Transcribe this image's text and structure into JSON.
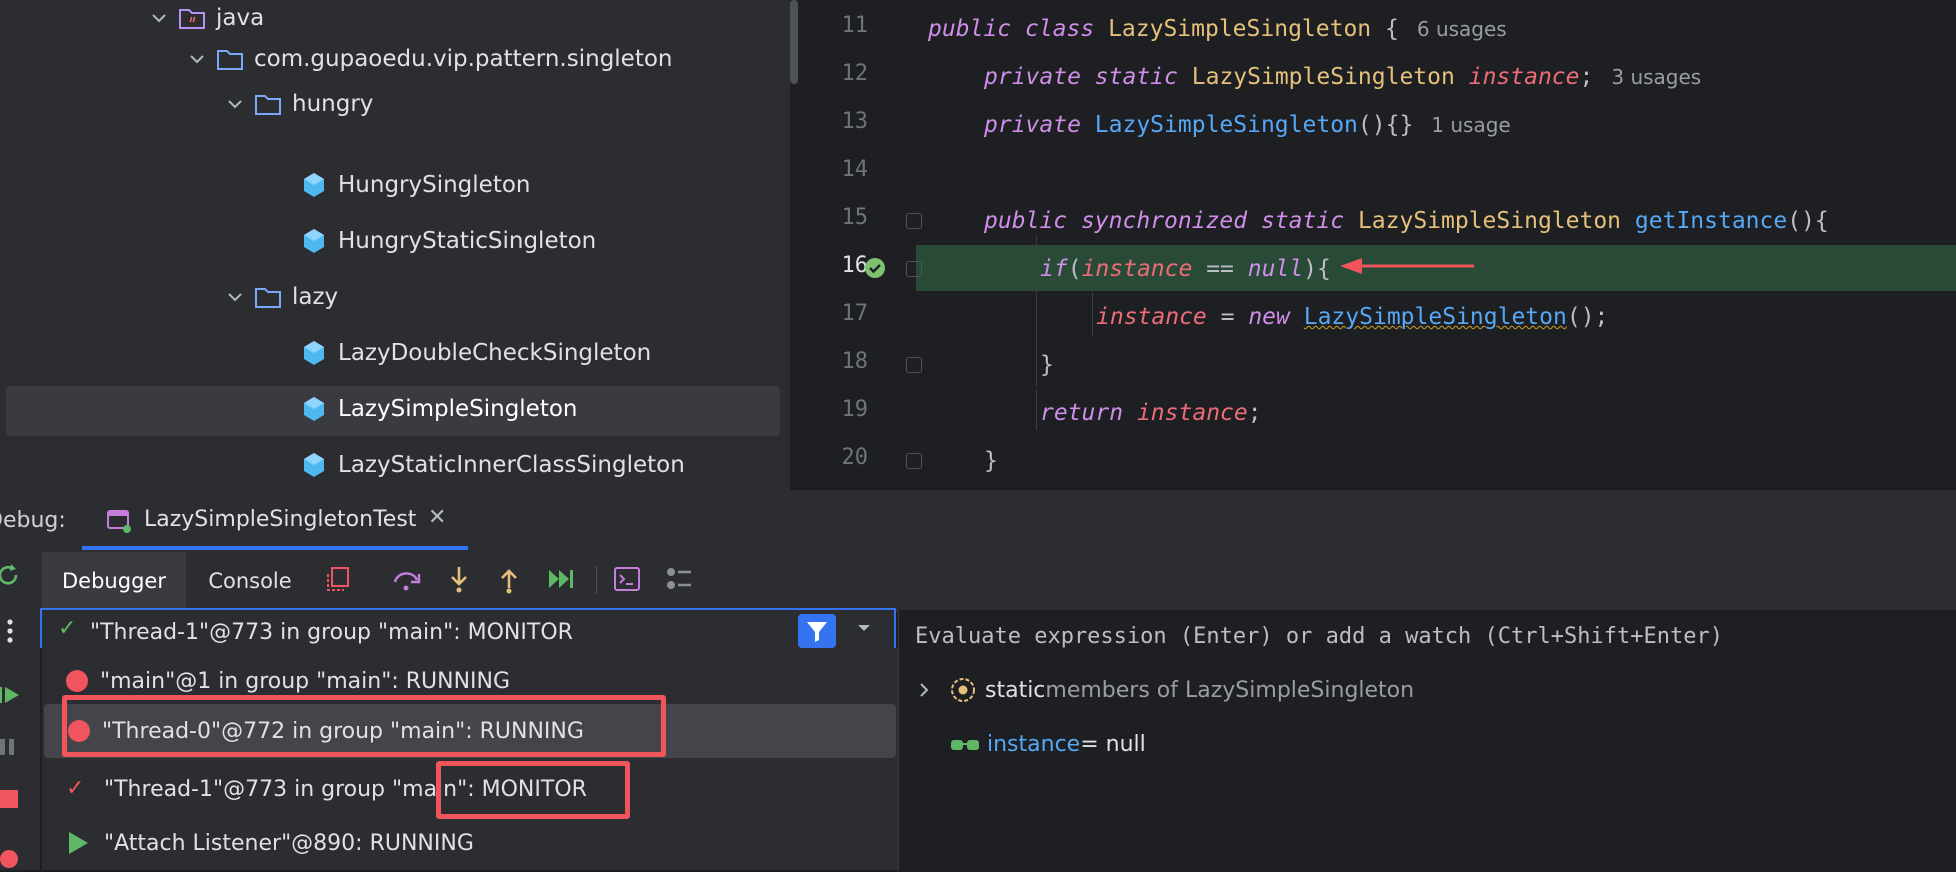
{
  "project_tree": {
    "items": [
      {
        "label": "java",
        "type": "source-folder"
      },
      {
        "label": "com.gupaoedu.vip.pattern.singleton",
        "type": "package"
      },
      {
        "label": "hungry",
        "type": "package"
      },
      {
        "label": "HungrySingleton",
        "type": "class"
      },
      {
        "label": "HungryStaticSingleton",
        "type": "class"
      },
      {
        "label": "lazy",
        "type": "package"
      },
      {
        "label": "LazyDoubleCheckSingleton",
        "type": "class"
      },
      {
        "label": "LazySimpleSingleton",
        "type": "class",
        "selected": true
      },
      {
        "label": "LazyStaticInnerClassSingleton",
        "type": "class"
      }
    ]
  },
  "editor": {
    "line_numbers": [
      "11",
      "12",
      "13",
      "14",
      "15",
      "16",
      "17",
      "18",
      "19",
      "20"
    ],
    "current_line": "16",
    "hints": {
      "l11": "6 usages",
      "l12": "3 usages",
      "l13": "1 usage"
    },
    "tokens": {
      "public": "public",
      "class": "class",
      "private": "private",
      "static": "static",
      "synchronized": "synchronized",
      "if": "if",
      "new": "new",
      "return": "return",
      "null": "null",
      "class_name": "LazySimpleSingleton",
      "field": "instance",
      "method": "getInstance",
      "brace_open": " {",
      "semi": ";",
      "ctor": "(){}",
      "paren_open_brace": "(){",
      "if_open": "(",
      "eq": " == ",
      "if_close": "){",
      "assign": " = ",
      "call": "();",
      "close": "}"
    }
  },
  "debug": {
    "label": "Debug:",
    "session_tab": "LazySimpleSingletonTest",
    "toolbar": {
      "tab_debugger": "Debugger",
      "tab_console": "Console"
    },
    "thread_combo_value": "\"Thread-1\"@773 in group \"main\": MONITOR",
    "threads": [
      {
        "label": "\"main\"@1 in group \"main\": RUNNING",
        "status": "breakpoint"
      },
      {
        "label": "\"Thread-0\"@772 in group \"main\": RUNNING",
        "status": "breakpoint",
        "selected": true
      },
      {
        "label_a": "\"Thread-1\"@773 in group \"main",
        "label_b": "\": MONITOR",
        "status": "check"
      },
      {
        "label": "\"Attach Listener\"@890: RUNNING",
        "status": "running"
      }
    ],
    "eval_placeholder": "Evaluate expression (Enter) or add a watch (Ctrl+Shift+Enter)",
    "variables": [
      {
        "keyword": "static",
        "rest": " members of LazySimpleSingleton"
      },
      {
        "name": "instance",
        "value": " = null"
      }
    ]
  },
  "colors": {
    "accent": "#3574f0",
    "breakpoint": "#f0545e",
    "annotation": "#f2545b",
    "exec_line": "#294a36"
  }
}
